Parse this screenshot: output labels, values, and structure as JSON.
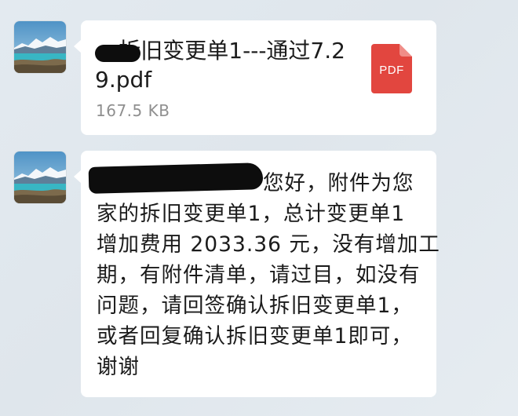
{
  "messages": [
    {
      "type": "file",
      "file_name": "---拆旧变更单1---通过7.29.pdf",
      "file_size": "167.5 KB",
      "file_type_label": "PDF",
      "icon": "pdf-file-icon",
      "avatar_icon": "landscape-avatar-icon"
    },
    {
      "type": "text",
      "avatar_icon": "landscape-avatar-icon",
      "lines": [
        "您好，附件为您",
        "家的拆旧变更单1，总计变更单1",
        "增加费用 2033.36 元，没有增加工",
        "期，有附件清单，请过目，如没有",
        "问题，请回签确认拆旧变更单1，",
        "或者回复确认拆旧变更单1即可，",
        "谢谢"
      ]
    }
  ],
  "colors": {
    "background": "#e3eaf0",
    "bubble": "#ffffff",
    "pdf_red": "#e2463f",
    "text": "#1b1b1b",
    "meta_text": "#8f8f8f"
  }
}
